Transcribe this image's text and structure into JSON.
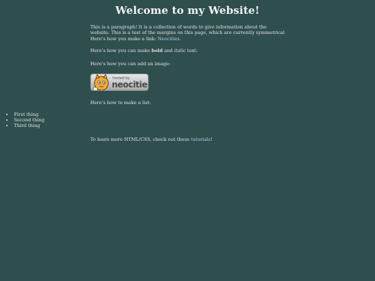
{
  "header": {
    "title": "Welcome to my Website!"
  },
  "intro": {
    "text_before_link": "This is a paragraph! It is a collection of words to give information about the website. This is a test of the margins on this page, which are currently symmetrical Here's how you make a link: ",
    "link_text": "Neocities",
    "text_after_link": "."
  },
  "formatting": {
    "prefix": "Here's how you can make ",
    "bold_text": "bold",
    "middle": " and ",
    "italic_text": "italic",
    "suffix": " text."
  },
  "image_section": {
    "label": "Here's how you can add an image:",
    "badge_small_text": "hosted by",
    "badge_brand_text": "neocities"
  },
  "list_section": {
    "label": "Here's how to make a list:",
    "items": [
      "First thing",
      "Second thing",
      "Third thing"
    ]
  },
  "footer": {
    "prefix": "To learn more HTML/CSS, check out these ",
    "link_text": "tutorials",
    "suffix": "!"
  },
  "colors": {
    "background": "#2f4f4f",
    "text": "#e3e3e3",
    "link": "#a7d4e6"
  }
}
